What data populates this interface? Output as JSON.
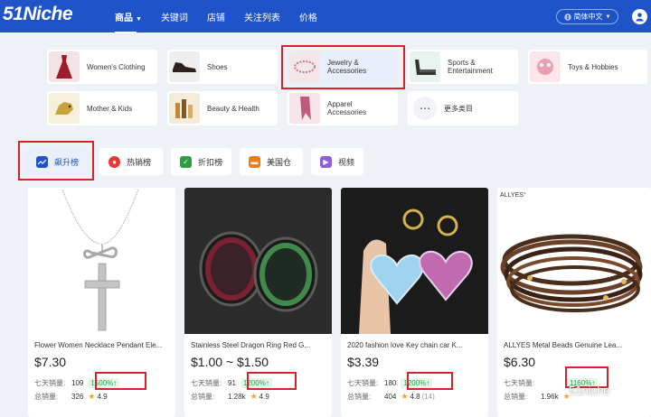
{
  "header": {
    "logo": "51Niche",
    "nav": [
      "商品",
      "关键词",
      "店铺",
      "关注列表",
      "价格"
    ],
    "lang": "简体中文"
  },
  "categories": [
    {
      "label": "Women's Clothing",
      "icon": "dress-icon",
      "color": "#9e1b2c"
    },
    {
      "label": "Shoes",
      "icon": "shoe-icon",
      "color": "#3a2a20"
    },
    {
      "label": "Jewelry & Accessories",
      "icon": "bracelet-icon",
      "color": "#c89aa8"
    },
    {
      "label": "Sports & Entertainment",
      "icon": "treadmill-icon",
      "color": "#444444"
    },
    {
      "label": "Toys & Hobbies",
      "icon": "toy-icon",
      "color": "#e9a0b4"
    },
    {
      "label": "Mother & Kids",
      "icon": "dinosaur-toy-icon",
      "color": "#c9a33a"
    },
    {
      "label": "Beauty & Health",
      "icon": "cosmetics-icon",
      "color": "#b88a3c"
    },
    {
      "label": "Apparel Accessories",
      "icon": "scarf-icon",
      "color": "#c05a7a"
    },
    {
      "label": "更多类目",
      "icon": "more-icon",
      "color": "#333333"
    }
  ],
  "tabs": [
    {
      "label": "飙升榜",
      "icon": "trend-icon",
      "color": "#1f53c8"
    },
    {
      "label": "热销榜",
      "icon": "fire-icon",
      "color": "#e53935"
    },
    {
      "label": "折扣榜",
      "icon": "discount-icon",
      "color": "#2e9e44"
    },
    {
      "label": "美国仓",
      "icon": "truck-icon",
      "color": "#f07a1a"
    },
    {
      "label": "视频",
      "icon": "video-icon",
      "color": "#8e5fd6"
    }
  ],
  "products": [
    {
      "title": "Flower Women Necklace Pendant Ele...",
      "price": "$7.30",
      "sales7_label": "七天销量:",
      "sales7": "109",
      "growth": "1500%↑",
      "total_label": "总销量:",
      "total": "326",
      "rating": "4.9",
      "rating_count": ""
    },
    {
      "title": "Stainless Steel Dragon Ring Red G...",
      "price": "$1.00 ~ $1.50",
      "sales7_label": "七天销量:",
      "sales7": "91",
      "growth": "1200%↑",
      "total_label": "总销量:",
      "total": "1.28k",
      "rating": "4.9",
      "rating_count": ""
    },
    {
      "title": "2020 fashion love Key chain car K...",
      "price": "$3.39",
      "sales7_label": "七天销量:",
      "sales7": "180",
      "growth": "1200%↑",
      "total_label": "总销量:",
      "total": "404",
      "rating": "4.8",
      "rating_count": "(14)"
    },
    {
      "title": "ALLYES Metal Beads Genuine Lea...",
      "price": "$6.30",
      "sales7_label": "七天销量:",
      "sales7": "",
      "growth": "1160%↑",
      "total_label": "总销量:",
      "total": "1.96k",
      "rating": "",
      "rating_count": "",
      "brand": "ALLYES°"
    }
  ],
  "watermark": "51niche"
}
